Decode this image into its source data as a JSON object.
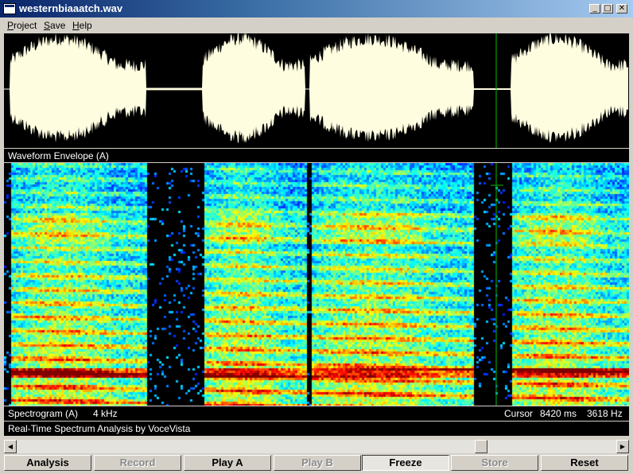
{
  "window": {
    "title": "westernbiaaatch.wav"
  },
  "caption_buttons": {
    "minimize": "_",
    "maximize": "□",
    "close": "✕"
  },
  "menu": [
    {
      "label": "Project",
      "accel": "P",
      "rest": "roject"
    },
    {
      "label": "Save",
      "accel": "S",
      "rest": "ave"
    },
    {
      "label": "Help",
      "accel": "H",
      "rest": "elp"
    }
  ],
  "panels": {
    "waveform_label": "Waveform Envelope (A)",
    "spectrogram_label": "Spectrogram (A)",
    "spectrogram_range": "4 kHz",
    "cursor_label": "Cursor",
    "cursor_time": "8420 ms",
    "cursor_freq": "3618 Hz",
    "status": "Real-Time Spectrum Analysis by VoceVista"
  },
  "scrollbar": {
    "left_icon": "arrow-left-icon",
    "right_icon": "arrow-right-icon",
    "position": 0.78
  },
  "toolbar": [
    {
      "id": "analysis",
      "label": "Analysis",
      "accel": "n",
      "state": "normal"
    },
    {
      "id": "record",
      "label": "Record",
      "state": "disabled"
    },
    {
      "id": "play-a",
      "label": "Play A",
      "state": "normal"
    },
    {
      "id": "play-b",
      "label": "Play B",
      "state": "disabled"
    },
    {
      "id": "freeze",
      "label": "Freeze",
      "state": "pressed"
    },
    {
      "id": "store",
      "label": "Store",
      "state": "disabled"
    },
    {
      "id": "reset",
      "label": "Reset",
      "state": "normal"
    }
  ],
  "colors": {
    "waveform": "#fffde0",
    "cursor_line": "#00c000",
    "title_start": "#0a246a",
    "title_end": "#a6caf0"
  }
}
